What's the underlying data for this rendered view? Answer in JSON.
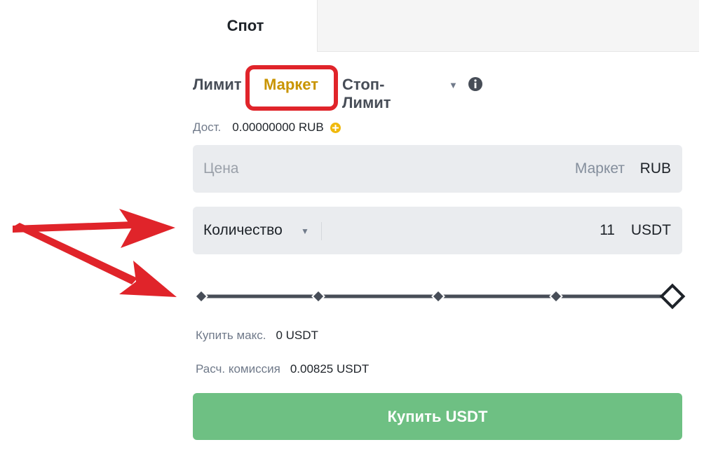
{
  "tabs": {
    "spot_label": "Спот"
  },
  "order_types": {
    "limit_label": "Лимит",
    "market_label": "Маркет",
    "stop_limit_label": "Стоп-Лимит",
    "active": "Маркет"
  },
  "available": {
    "label": "Дост.",
    "value": "0.00000000 RUB"
  },
  "price_field": {
    "placeholder": "Цена",
    "mode": "Маркет",
    "unit": "RUB"
  },
  "quantity_field": {
    "label": "Количество",
    "value": "11",
    "unit": "USDT"
  },
  "slider": {
    "percent": 100,
    "stops": [
      0,
      25,
      50,
      75,
      100
    ]
  },
  "info": {
    "buy_max_label": "Купить макс.",
    "buy_max_value": "0 USDT",
    "fee_label": "Расч. комиссия",
    "fee_value": "0.00825 USDT"
  },
  "buy_button": {
    "label": "Купить USDT"
  },
  "colors": {
    "accent": "#c99400",
    "buy_green": "#6ec083",
    "highlight_red": "#e0242a",
    "field_bg": "#eaecef"
  },
  "icons": [
    "info-icon",
    "plus-circle-icon",
    "caret-down-icon",
    "arrow-annotation"
  ]
}
